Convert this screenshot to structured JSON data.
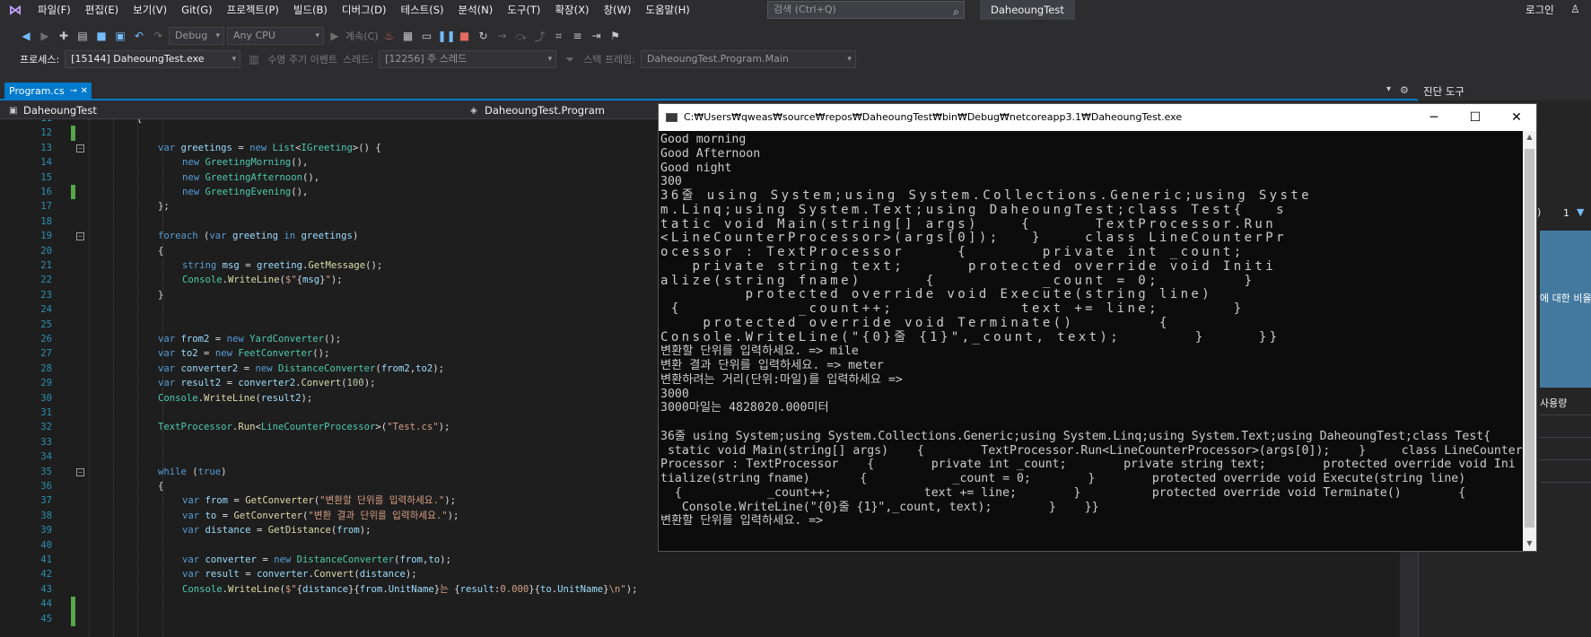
{
  "menubar": {
    "items": [
      "파일(F)",
      "편집(E)",
      "보기(V)",
      "Git(G)",
      "프로젝트(P)",
      "빌드(B)",
      "디버그(D)",
      "테스트(S)",
      "분석(N)",
      "도구(T)",
      "확장(X)",
      "창(W)",
      "도움말(H)"
    ],
    "search_placeholder": "검색 (Ctrl+Q)",
    "solution_title": "DaheoungTest",
    "login": "로그인"
  },
  "toolbar": {
    "config": "Debug",
    "platform": "Any CPU",
    "continue": "계속(C)",
    "process_label": "프로세스:",
    "process_value": "[15144] DaheoungTest.exe",
    "lifecycle": "수명 주기 이벤트",
    "thread_label": "스레드:",
    "thread_value": "[12256] 주 스레드",
    "stack_label": "스택 프레임:",
    "stack_value": "DaheoungTest.Program.Main"
  },
  "editor": {
    "tab": "Program.cs",
    "nav_left": "DaheoungTest",
    "nav_mid": "DaheoungTest.Program",
    "lines": [
      {
        "n": "11",
        "html": "{",
        "indent": 0
      },
      {
        "n": "12",
        "html": "",
        "indent": 0
      },
      {
        "n": "13",
        "html": "<span class='k'>var</span> <span class='v'>greetings</span> = <span class='k'>new</span> <span class='t'>List</span>&lt;<span class='t'>IGreeting</span>&gt;() {",
        "indent": 1
      },
      {
        "n": "14",
        "html": "<span class='k'>new</span> <span class='t'>GreetingMorning</span>(),",
        "indent": 2
      },
      {
        "n": "15",
        "html": "<span class='k'>new</span> <span class='t'>GreetingAfternoon</span>(),",
        "indent": 2
      },
      {
        "n": "16",
        "html": "<span class='k'>new</span> <span class='t'>GreetingEvening</span>(),",
        "indent": 2
      },
      {
        "n": "17",
        "html": "};",
        "indent": 1
      },
      {
        "n": "18",
        "html": "",
        "indent": 0
      },
      {
        "n": "19",
        "html": "<span class='k'>foreach</span> (<span class='k'>var</span> <span class='v'>greeting</span> <span class='k'>in</span> <span class='v'>greetings</span>)",
        "indent": 1
      },
      {
        "n": "20",
        "html": "{",
        "indent": 1
      },
      {
        "n": "21",
        "html": "<span class='k'>string</span> <span class='v'>msg</span> = <span class='v'>greeting</span>.<span class='m'>GetMessage</span>();",
        "indent": 2
      },
      {
        "n": "22",
        "html": "<span class='t'>Console</span>.<span class='m'>WriteLine</span>(<span class='s'>$\"</span>{<span class='v'>msg</span>}<span class='s'>\"</span>);",
        "indent": 2
      },
      {
        "n": "23",
        "html": "}",
        "indent": 1
      },
      {
        "n": "24",
        "html": "",
        "indent": 0
      },
      {
        "n": "25",
        "html": "",
        "indent": 0
      },
      {
        "n": "26",
        "html": "<span class='k'>var</span> <span class='v'>from2</span> = <span class='k'>new</span> <span class='t'>YardConverter</span>();",
        "indent": 1
      },
      {
        "n": "27",
        "html": "<span class='k'>var</span> <span class='v'>to2</span> = <span class='k'>new</span> <span class='t'>FeetConverter</span>();",
        "indent": 1
      },
      {
        "n": "28",
        "html": "<span class='k'>var</span> <span class='v'>converter2</span> = <span class='k'>new</span> <span class='t'>DistanceConverter</span>(<span class='v'>from2</span>,<span class='v'>to2</span>);",
        "indent": 1
      },
      {
        "n": "29",
        "html": "<span class='k'>var</span> <span class='v'>result2</span> = <span class='v'>converter2</span>.<span class='m'>Convert</span>(<span class='n'>100</span>);",
        "indent": 1
      },
      {
        "n": "30",
        "html": "<span class='t'>Console</span>.<span class='m'>WriteLine</span>(<span class='v'>result2</span>);",
        "indent": 1
      },
      {
        "n": "31",
        "html": "",
        "indent": 0
      },
      {
        "n": "32",
        "html": "<span class='t'>TextProcessor</span>.<span class='m'>Run</span>&lt;<span class='t'>LineCounterProcessor</span>&gt;(<span class='s'>\"Test.cs\"</span>);",
        "indent": 1
      },
      {
        "n": "33",
        "html": "",
        "indent": 0
      },
      {
        "n": "34",
        "html": "",
        "indent": 0
      },
      {
        "n": "35",
        "html": "<span class='k'>while</span> (<span class='k'>true</span>)",
        "indent": 1
      },
      {
        "n": "36",
        "html": "{",
        "indent": 1
      },
      {
        "n": "37",
        "html": "<span class='k'>var</span> <span class='v'>from</span> = <span class='m'>GetConverter</span>(<span class='s'>\"변환할 단위를 입력하세요.\"</span>);",
        "indent": 2
      },
      {
        "n": "38",
        "html": "<span class='k'>var</span> <span class='v'>to</span> = <span class='m'>GetConverter</span>(<span class='s'>\"변환 결과 단위를 입력하세요.\"</span>);",
        "indent": 2
      },
      {
        "n": "39",
        "html": "<span class='k'>var</span> <span class='v'>distance</span> = <span class='m'>GetDistance</span>(<span class='v'>from</span>);",
        "indent": 2
      },
      {
        "n": "40",
        "html": "",
        "indent": 0
      },
      {
        "n": "41",
        "html": "<span class='k'>var</span> <span class='v'>converter</span> = <span class='k'>new</span> <span class='t'>DistanceConverter</span>(<span class='v'>from</span>,<span class='v'>to</span>);",
        "indent": 2
      },
      {
        "n": "42",
        "html": "<span class='k'>var</span> <span class='v'>result</span> = <span class='v'>converter</span>.<span class='m'>Convert</span>(<span class='v'>distance</span>);",
        "indent": 2
      },
      {
        "n": "43",
        "html": "<span class='t'>Console</span>.<span class='m'>WriteLine</span>(<span class='s'>$\"</span>{<span class='v'>distance</span>}{<span class='v'>from</span>.<span class='v'>UnitName</span>}<span class='s'>는 </span>{<span class='v'>result</span>:<span class='s'>0.000</span>}{<span class='v'>to</span>.<span class='v'>UnitName</span>}<span class='s'>\\n\"</span>);",
        "indent": 2
      },
      {
        "n": "44",
        "html": "",
        "indent": 0
      },
      {
        "n": "45",
        "html": "",
        "indent": 0
      }
    ],
    "changed": [
      "12",
      "16",
      "44",
      "45"
    ],
    "folds": [
      "13",
      "19",
      "35"
    ]
  },
  "console": {
    "title": "C:₩Users₩qweas₩source₩repos₩DaheoungTest₩bin₩Debug₩netcoreapp3.1₩DaheoungTest.exe",
    "lines": [
      {
        "t": "Good morning",
        "w": false
      },
      {
        "t": "Good Afternoon",
        "w": false
      },
      {
        "t": "Good night",
        "w": false
      },
      {
        "t": "300",
        "w": false
      },
      {
        "t": "36줄 using System;using System.Collections.Generic;using Syste",
        "w": true
      },
      {
        "t": "m.Linq;using System.Text;using DaheoungTest;class Test{   s",
        "w": true
      },
      {
        "t": "tatic void Main(string[] args)    {      TextProcessor.Run",
        "w": true
      },
      {
        "t": "<LineCounterProcessor>(args[0]);   }    class LineCounterPr",
        "w": true
      },
      {
        "t": "ocessor : TextProcessor     {       private int _count;",
        "w": true
      },
      {
        "t": "   private string text;      protected override void Initi",
        "w": true
      },
      {
        "t": "alize(string fname)      {          _count = 0;        }",
        "w": true
      },
      {
        "t": "        protected override void Execute(string line)",
        "w": true
      },
      {
        "t": " {           _count++;            text += line;       }",
        "w": true
      },
      {
        "t": "    protected override void Terminate()        {",
        "w": true
      },
      {
        "t": "Console.WriteLine(\"{0}줄 {1}\",_count, text);       }     }}",
        "w": true
      },
      {
        "t": "변환할 단위를 입력하세요. => mile",
        "w": false
      },
      {
        "t": "변환 결과 단위를 입력하세요. => meter",
        "w": false
      },
      {
        "t": "변환하려는 거리(단위:마일)를 입력하세요 =>",
        "w": false
      },
      {
        "t": "3000",
        "w": false
      },
      {
        "t": "3000마일는 4828020.000미터",
        "w": false
      },
      {
        "t": "",
        "w": false
      },
      {
        "t": "36줄 using System;using System.Collections.Generic;using System.Linq;using System.Text;using DaheoungTest;class Test{",
        "w": false
      },
      {
        "t": " static void Main(string[] args)    {        TextProcessor.Run<LineCounterProcessor>(args[0]);    }     class LineCounter",
        "w": false
      },
      {
        "t": "Processor : TextProcessor    {        private int _count;        private string text;        protected override void Ini",
        "w": false
      },
      {
        "t": "tialize(string fname)       {            _count = 0;        }        protected override void Execute(string line)",
        "w": false
      },
      {
        "t": "  {            _count++;             text += line;        }          protected override void Terminate()        {",
        "w": false
      },
      {
        "t": "   Console.WriteLine(\"{0}줄 {1}\",_count, text);        }    }}",
        "w": false
      },
      {
        "t": "변환할 단위를 입력하세요. =>",
        "w": false
      }
    ]
  },
  "right_panel": {
    "title": "진단 도구",
    "count": "1",
    "label1": "에 대한 비율",
    "label2": "사용량"
  }
}
